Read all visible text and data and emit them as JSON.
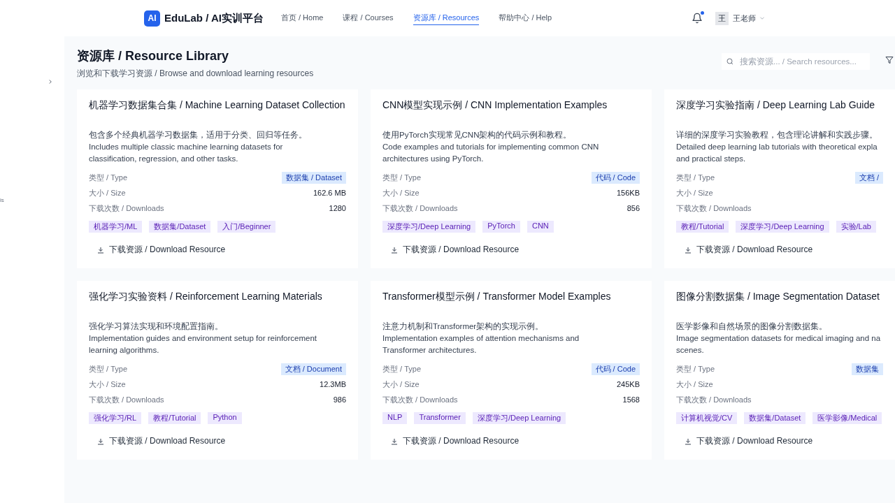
{
  "brand": {
    "logo": "AI",
    "name": "EduLab / AI实训平台"
  },
  "nav": [
    {
      "label": "首页 / Home",
      "selected": false
    },
    {
      "label": "课程 / Courses",
      "selected": false
    },
    {
      "label": "资源库 / Resources",
      "selected": true
    },
    {
      "label": "帮助中心 / Help",
      "selected": false
    }
  ],
  "notifications": {
    "unread": true
  },
  "user": {
    "avatar": "王",
    "name": "王老师"
  },
  "sidebar": {
    "collapsed_text": "is"
  },
  "page": {
    "title": "资源库 / Resource Library",
    "subtitle": "浏览和下载学习资源 / Browse and download learning resources"
  },
  "search": {
    "placeholder": "搜索资源... / Search resources..."
  },
  "resources": [
    {
      "title": "机器学习数据集合集 / Machine Learning Dataset Collection",
      "description": [
        "包含多个经典机器学习数据集，适用于分类、回归等任务。",
        "Includes multiple classic machine learning datasets for",
        "classification, regression, and other tasks."
      ],
      "type_label": "类型 / Type",
      "type": "数据集 / Dataset",
      "size_label": "大小 / Size",
      "size": "162.6 MB",
      "downloads_label": "下载次数 / Downloads",
      "downloads": "1280",
      "tags": [
        "机器学习/ML",
        "数据集/Dataset",
        "入门/Beginner"
      ],
      "action": "下载资源 / Download Resource"
    },
    {
      "title": "CNN模型实现示例 / CNN Implementation Examples",
      "description": [
        "使用PyTorch实现常见CNN架构的代码示例和教程。",
        "Code examples and tutorials for implementing common CNN",
        "architectures using PyTorch."
      ],
      "type_label": "类型 / Type",
      "type": "代码 / Code",
      "size_label": "大小 / Size",
      "size": "156KB",
      "downloads_label": "下载次数 / Downloads",
      "downloads": "856",
      "tags": [
        "深度学习/Deep Learning",
        "PyTorch",
        "CNN"
      ],
      "action": "下载资源 / Download Resource"
    },
    {
      "title": "深度学习实验指南 / Deep Learning Lab Guide",
      "description": [
        "详细的深度学习实验教程，包含理论讲解和实践步骤。",
        "Detailed deep learning lab tutorials with theoretical expla",
        "and practical steps."
      ],
      "type_label": "类型 / Type",
      "type": "文档 /",
      "size_label": "大小 / Size",
      "downloads_label": "下载次数 / Downloads",
      "tags": [
        "教程/Tutorial",
        "深度学习/Deep Learning",
        "实验/Lab"
      ],
      "action": "下载资源 / Download Resource"
    },
    {
      "title": "强化学习实验资料 / Reinforcement Learning Materials",
      "description": [
        "强化学习算法实现和环境配置指南。",
        "Implementation guides and environment setup for reinforcement",
        "learning algorithms."
      ],
      "type_label": "类型 / Type",
      "type": "文档 / Document",
      "size_label": "大小 / Size",
      "size": "12.3MB",
      "downloads_label": "下载次数 / Downloads",
      "downloads": "986",
      "tags": [
        "强化学习/RL",
        "教程/Tutorial",
        "Python"
      ],
      "action": "下载资源 / Download Resource"
    },
    {
      "title": "Transformer模型示例 / Transformer Model Examples",
      "description": [
        "注意力机制和Transformer架构的实现示例。",
        "Implementation examples of attention mechanisms and",
        "Transformer architectures."
      ],
      "type_label": "类型 / Type",
      "type": "代码 / Code",
      "size_label": "大小 / Size",
      "size": "245KB",
      "downloads_label": "下载次数 / Downloads",
      "downloads": "1568",
      "tags": [
        "NLP",
        "Transformer",
        "深度学习/Deep Learning"
      ],
      "action": "下载资源 / Download Resource"
    },
    {
      "title": "图像分割数据集 / Image Segmentation Dataset",
      "description": [
        "医学影像和自然场景的图像分割数据集。",
        "Image segmentation datasets for medical imaging and na",
        "scenes."
      ],
      "type_label": "类型 / Type",
      "type": "数据集",
      "size_label": "大小 / Size",
      "downloads_label": "下载次数 / Downloads",
      "tags": [
        "计算机视觉/CV",
        "数据集/Dataset",
        "医学影像/Medical"
      ],
      "action": "下载资源 / Download Resource"
    }
  ]
}
